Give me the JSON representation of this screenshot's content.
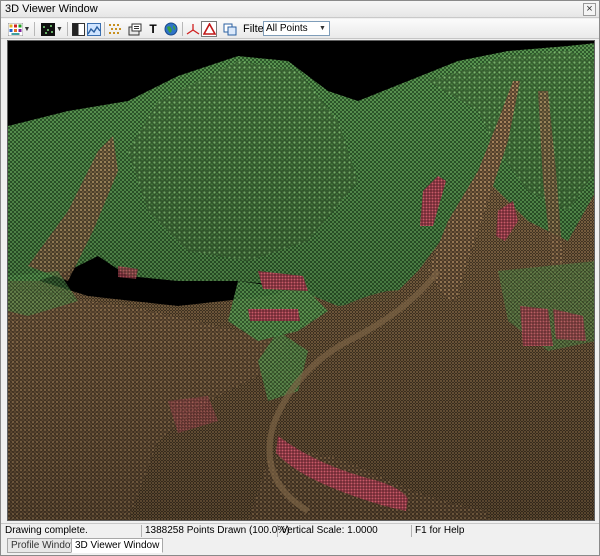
{
  "window": {
    "title": "3D Viewer Window",
    "close_glyph": "×"
  },
  "toolbar": {
    "icons": [
      "color-mode-icon",
      "point-display-icon",
      "split-view-icon",
      "terrain-view-icon",
      "classify-icon",
      "export-icon",
      "text-icon",
      "globe-icon",
      "axes-icon",
      "triangle-icon",
      "copy-icon"
    ],
    "text_glyph": "T",
    "filter_label": "Filter:",
    "filter_value": "All Points"
  },
  "status": {
    "message": "Drawing complete.",
    "points": "1388258 Points Drawn (100.0%)",
    "vertical_scale": "Vertical Scale: 1.0000",
    "help": "F1 for Help"
  },
  "tabs": [
    {
      "label": "Profile Window",
      "active": false
    },
    {
      "label": "3D Viewer Window",
      "active": true
    }
  ],
  "colors": {
    "canvas_bg": "#000000",
    "vegetation": "#3f7a3a",
    "ground": "#9a7a52",
    "building": "#b24a55"
  }
}
